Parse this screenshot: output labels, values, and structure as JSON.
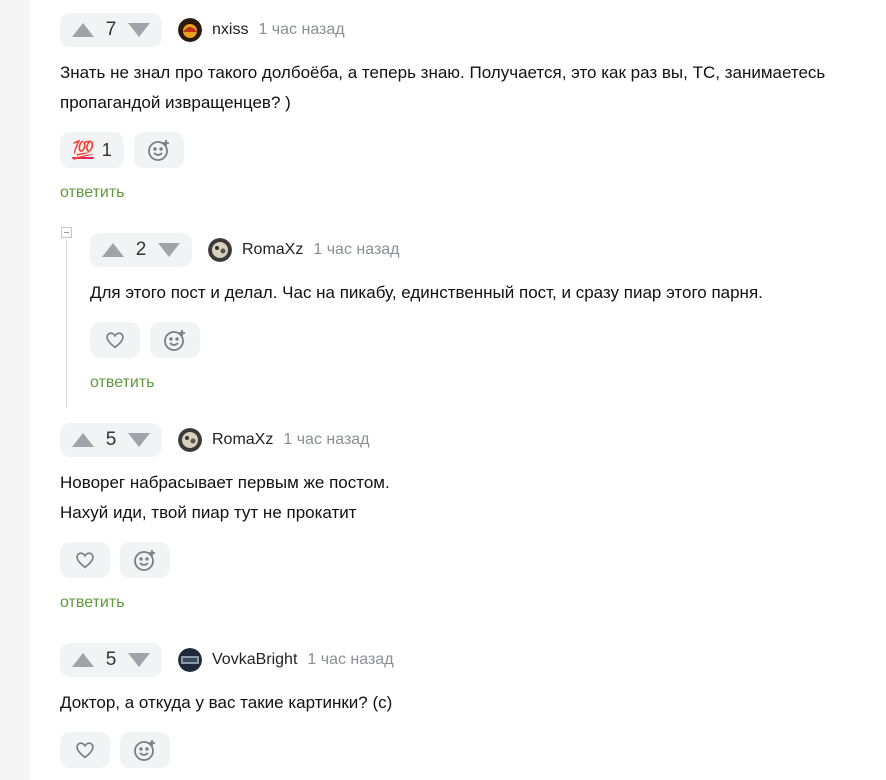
{
  "colors": {
    "accent": "#5d9a3a",
    "muted": "#8a8f95",
    "chip_bg": "#f2f3f5"
  },
  "comments": [
    {
      "votes": "7",
      "author": "nxiss",
      "time": "1 час назад",
      "lines": [
        "Знать не знал про такого долбоёба, а теперь знаю. Получается, это как раз вы, ТС, занимаетесь",
        "пропагандой извращенцев? )"
      ],
      "reaction": {
        "icon": "hundred-points-emoji",
        "label": "💯",
        "count": "1"
      },
      "reply_label": "ответить"
    },
    {
      "votes": "2",
      "author": "RomaXz",
      "time": "1 час назад",
      "lines": [
        "Для этого пост и делал. Час на пикабу, единственный пост, и сразу пиар этого парня."
      ],
      "reply_label": "ответить"
    },
    {
      "votes": "5",
      "author": "RomaXz",
      "time": "1 час назад",
      "lines": [
        "Новорег набрасывает первым же постом.",
        "Нахуй иди, твой пиар тут не прокатит"
      ],
      "reply_label": "ответить"
    },
    {
      "votes": "5",
      "author": "VovkaBright",
      "time": "1 час назад",
      "lines": [
        "Доктор, а откуда у вас такие картинки? (с)"
      ]
    }
  ]
}
